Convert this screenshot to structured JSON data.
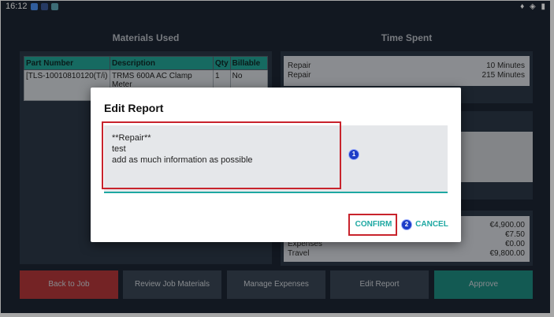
{
  "status_bar": {
    "time": "16:12",
    "right_icons": "♦ ◈ ▮"
  },
  "materials": {
    "title": "Materials Used",
    "columns": [
      "Part Number",
      "Description",
      "Qty",
      "Billable"
    ],
    "rows": [
      {
        "part_number": "[TLS-10010810120(T/i)",
        "description": "TRMS 600A AC Clamp Meter",
        "qty": "1",
        "billable": "No"
      }
    ]
  },
  "time_spent": {
    "title": "Time Spent",
    "rows": [
      {
        "label": "Repair",
        "value": "10 Minutes"
      },
      {
        "label": "Repair",
        "value": "215 Minutes"
      }
    ]
  },
  "totals": {
    "values": [
      "€4,900.00",
      "€7.50",
      "€0.00",
      "€9,800.00"
    ],
    "labels": [
      "Expenses",
      "Travel"
    ]
  },
  "buttons": {
    "back": "Back to Job",
    "review": "Review Job Materials",
    "expenses": "Manage Expenses",
    "edit_report": "Edit Report",
    "approve": "Approve"
  },
  "dialog": {
    "title": "Edit Report",
    "text": "**Repair**\ntest\nadd as much information as possible",
    "confirm": "CONFIRM",
    "cancel": "CANCEL",
    "marker1": "1",
    "marker2": "2"
  },
  "colors": {
    "background": "#1c2533",
    "accent": "#1ea8a2",
    "back_button": "#b3363a",
    "approve_button": "#1e8a80",
    "highlight": "#c8232c"
  }
}
